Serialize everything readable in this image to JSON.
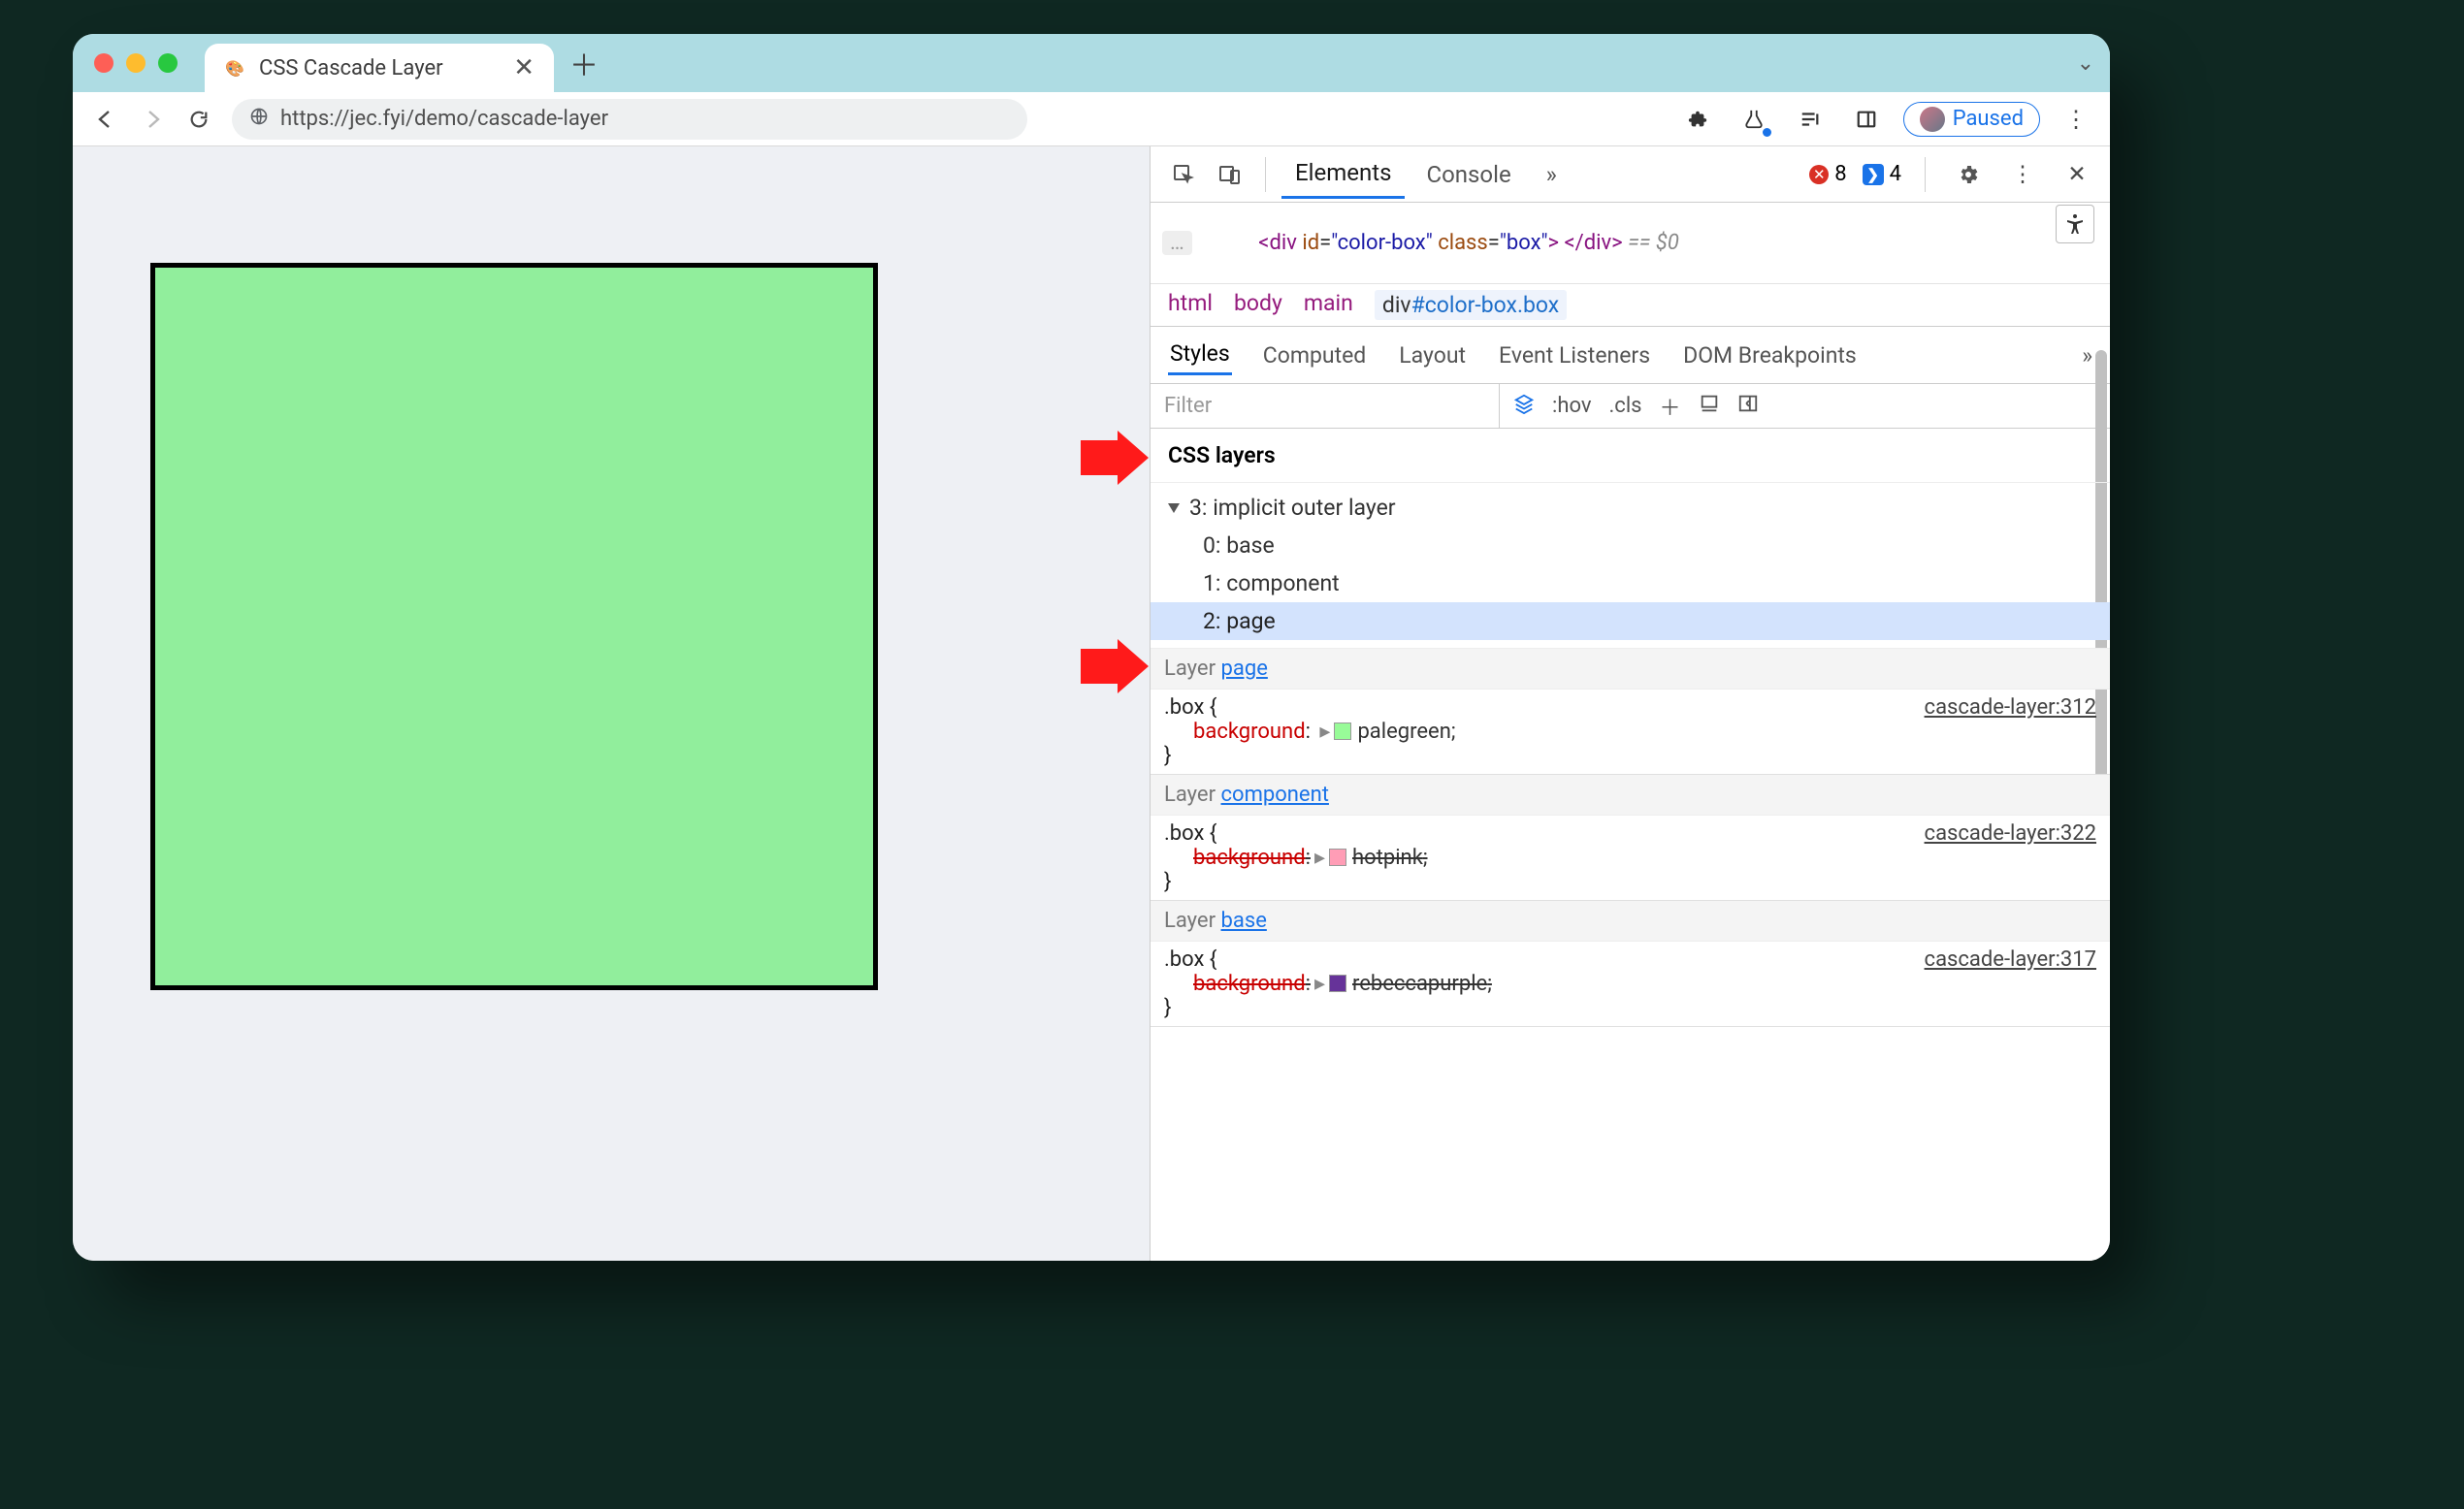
{
  "tab": {
    "title": "CSS Cascade Layer"
  },
  "url": {
    "text": "https://jec.fyi/demo/cascade-layer"
  },
  "paused": {
    "label": "Paused"
  },
  "devtools": {
    "tabs": {
      "elements": "Elements",
      "console": "Console"
    },
    "errors": "8",
    "messages": "4",
    "elementLine": {
      "prefix": "<div ",
      "idAttr": "id",
      "idVal": "\"color-box\"",
      "classAttr": "class",
      "classVal": "\"box\"",
      "close": "> </div>",
      "suffix": " == $0"
    },
    "crumbs": {
      "c1": "html",
      "c2": "body",
      "c3": "main",
      "c4a": "div",
      "c4b": "#color-box.box"
    },
    "subtabs": {
      "styles": "Styles",
      "computed": "Computed",
      "layout": "Layout",
      "events": "Event Listeners",
      "dom": "DOM Breakpoints"
    },
    "filter": {
      "placeholder": "Filter",
      "hov": ":hov",
      "cls": ".cls"
    },
    "layerSection": {
      "title": "CSS layers"
    },
    "layerTree": {
      "root": "3: implicit outer layer",
      "i0": "0: base",
      "i1": "1: component",
      "i2": "2: page"
    },
    "rules": {
      "layerWord": "Layer ",
      "page": {
        "label": "page",
        "selector": ".box {",
        "prop": "background",
        "val": "palegreen",
        "close": "}",
        "src": "cascade-layer:312"
      },
      "component": {
        "label": "component",
        "selector": ".box {",
        "prop": "background",
        "val": "hotpink",
        "close": "}",
        "src": "cascade-layer:322"
      },
      "base": {
        "label": "base",
        "selector": ".box {",
        "prop": "background",
        "val": "rebeccapurple",
        "close": "}",
        "src": "cascade-layer:317"
      }
    }
  }
}
